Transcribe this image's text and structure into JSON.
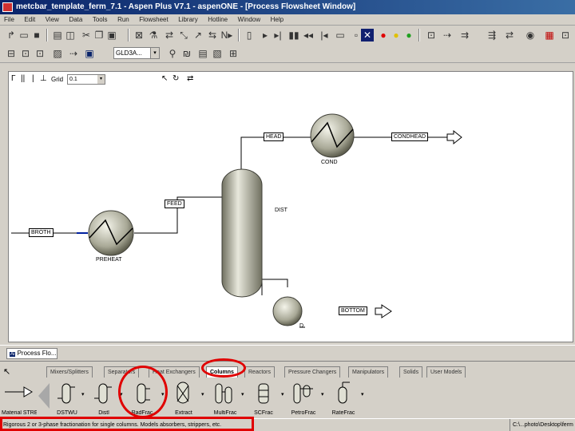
{
  "window": {
    "title": "metcbar_template_ferm_7.1 - Aspen Plus V7.1 - aspenONE - [Process Flowsheet Window]"
  },
  "menu": [
    "File",
    "Edit",
    "View",
    "Data",
    "Tools",
    "Run",
    "Flowsheet",
    "Library",
    "Hotline",
    "Window",
    "Help"
  ],
  "toolbar2": {
    "combo_value": "GLD3A..."
  },
  "flowsheet_toolbar": {
    "grid_label": "Grid",
    "grid_value": "0.1"
  },
  "flowsheet": {
    "blocks": [
      {
        "name": "COND"
      },
      {
        "name": "DIST"
      },
      {
        "name": "PREHEAT"
      },
      {
        "name": "D"
      }
    ],
    "streams": [
      "HEAD",
      "CONDHEAD",
      "FEED",
      "BROTH",
      "BOTTOM"
    ]
  },
  "window_tab": {
    "label": "Process Flo..."
  },
  "library_tabs": [
    "Mixers/Splitters",
    "Separators",
    "Heat Exchangers",
    "Columns",
    "Reactors",
    "Pressure Changers",
    "Manipulators",
    "Solids",
    "User Models"
  ],
  "library_active_tab": "Columns",
  "models": [
    {
      "name": "Material STREAMS"
    },
    {
      "name": "DSTWU"
    },
    {
      "name": "Distl"
    },
    {
      "name": "RadFrac"
    },
    {
      "name": "Extract"
    },
    {
      "name": "MultiFrac"
    },
    {
      "name": "SCFrac"
    },
    {
      "name": "PetroFrac"
    },
    {
      "name": "RateFrac"
    }
  ],
  "status": {
    "message": "Rigorous 2 or 3-phase fractionation for single columns. Models absorbers, strippers, etc.",
    "path": "C:\\...photo\\Desktop\\ferm"
  },
  "colors": {
    "highlight": "#e00000",
    "title_bar": "#0a246a",
    "vessel": "#cfcfbd"
  }
}
